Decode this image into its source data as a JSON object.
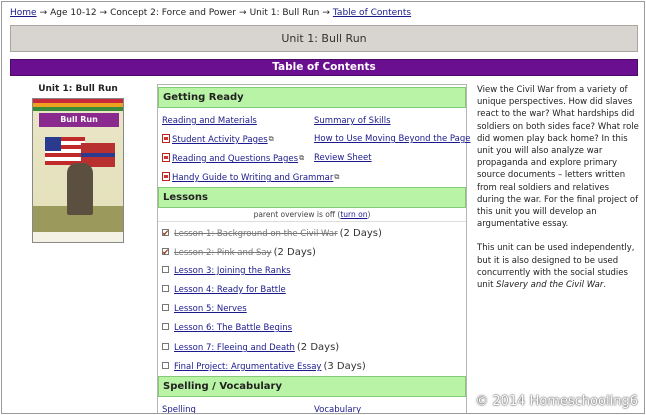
{
  "breadcrumb": {
    "home": "Home",
    "age": "Age 10-12",
    "concept": "Concept 2: Force and Power",
    "unit": "Unit 1: Bull Run",
    "current": "Table of Contents"
  },
  "banner": {
    "title": "Unit 1: Bull Run"
  },
  "toc": {
    "title": "Table of Contents"
  },
  "book": {
    "title": "Unit 1: Bull Run",
    "cover_title": "Bull Run"
  },
  "getting_ready": {
    "heading": "Getting Ready",
    "links": [
      {
        "label": "Reading and Materials",
        "pdf": false,
        "ext": false
      },
      {
        "label": "Summary of Skills",
        "pdf": false,
        "ext": false
      },
      {
        "label": "Student Activity Pages",
        "pdf": true,
        "ext": true
      },
      {
        "label": "How to Use Moving Beyond the Page",
        "pdf": false,
        "ext": false
      },
      {
        "label": "Reading and Questions Pages",
        "pdf": true,
        "ext": true
      },
      {
        "label": "Review Sheet",
        "pdf": false,
        "ext": false
      },
      {
        "label": "Handy Guide to Writing and Grammar",
        "pdf": true,
        "ext": true
      },
      {
        "label": "",
        "pdf": false,
        "ext": false
      }
    ]
  },
  "lessons": {
    "heading": "Lessons",
    "overview_text": "parent overview is off",
    "overview_toggle": "turn on",
    "items": [
      {
        "label": "Lesson 1: Background on the Civil War",
        "days": "(2 Days)",
        "done": true
      },
      {
        "label": "Lesson 2: Pink and Say",
        "days": "(2 Days)",
        "done": true
      },
      {
        "label": "Lesson 3: Joining the Ranks",
        "days": "",
        "done": false
      },
      {
        "label": "Lesson 4: Ready for Battle",
        "days": "",
        "done": false
      },
      {
        "label": "Lesson 5: Nerves",
        "days": "",
        "done": false
      },
      {
        "label": "Lesson 6: The Battle Begins",
        "days": "",
        "done": false
      },
      {
        "label": "Lesson 7: Fleeing and Death",
        "days": "(2 Days)",
        "done": false
      },
      {
        "label": "Final Project: Argumentative Essay",
        "days": "(3 Days)",
        "done": false
      }
    ]
  },
  "spelling": {
    "heading": "Spelling / Vocabulary",
    "links": [
      "Spelling",
      "Vocabulary"
    ]
  },
  "description": {
    "p1": "View the Civil War from a variety of unique perspectives. How did slaves react to the war? What hardships did soldiers on both sides face? What role did women play back home? In this unit you will also analyze war propaganda and explore primary source documents – letters written from real soldiers and relatives during the war. For the final project of this unit you will develop an argumentative essay.",
    "p2_pre": "This unit can be used independently, but it is also designed to be used concurrently with the social studies unit ",
    "p2_em": "Slavery and the Civil War",
    "p2_post": "."
  },
  "watermark": "© 2014 Homeschooling6"
}
